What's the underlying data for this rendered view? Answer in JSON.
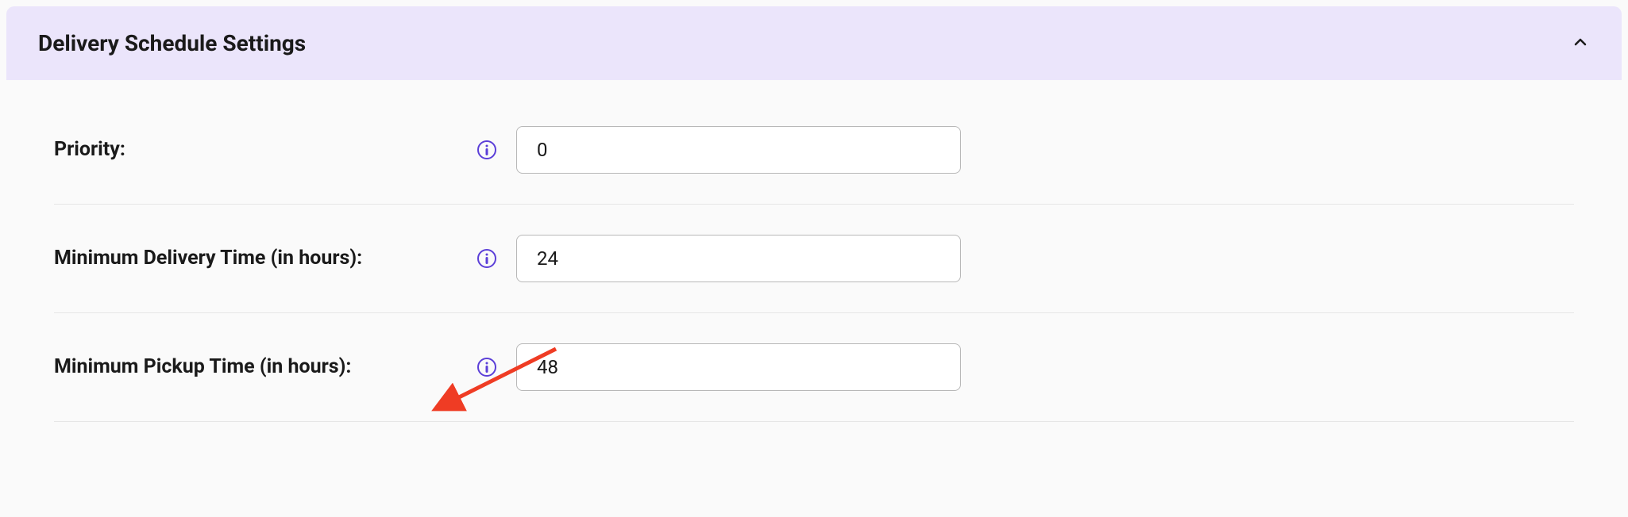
{
  "panel": {
    "title": "Delivery Schedule Settings"
  },
  "fields": {
    "priority": {
      "label": "Priority:",
      "value": "0"
    },
    "min_delivery": {
      "label": "Minimum Delivery Time (in hours):",
      "value": "24"
    },
    "min_pickup": {
      "label": "Minimum Pickup Time (in hours):",
      "value": "48"
    }
  }
}
